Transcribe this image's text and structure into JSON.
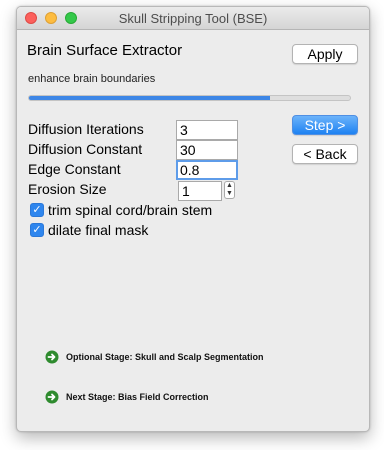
{
  "window": {
    "title": "Skull Stripping Tool (BSE)"
  },
  "header": {
    "title": "Brain Surface Extractor",
    "apply_label": "Apply"
  },
  "status": {
    "description": "enhance brain boundaries",
    "progress": 0.75
  },
  "nav": {
    "step_label": "Step >",
    "back_label": "< Back"
  },
  "params": [
    {
      "label": "Diffusion Iterations",
      "value": "3"
    },
    {
      "label": "Diffusion Constant",
      "value": "30"
    },
    {
      "label": "Edge Constant",
      "value": "0.8"
    },
    {
      "label": "Erosion Size",
      "value": "1"
    }
  ],
  "stepper": {
    "up": "▲",
    "down": "▼"
  },
  "options": [
    {
      "label": "trim spinal cord/brain stem",
      "checked": true
    },
    {
      "label": "dilate final mask",
      "checked": true
    }
  ],
  "stages": [
    {
      "label": "Optional Stage: Skull and Scalp Segmentation",
      "icon": "right-arrow-circle-icon"
    },
    {
      "label": "Next Stage: Bias Field Correction",
      "icon": "right-arrow-circle-icon"
    }
  ],
  "colors": {
    "accent": "#1e82f2",
    "stage_icon": "#2e8b2e"
  }
}
